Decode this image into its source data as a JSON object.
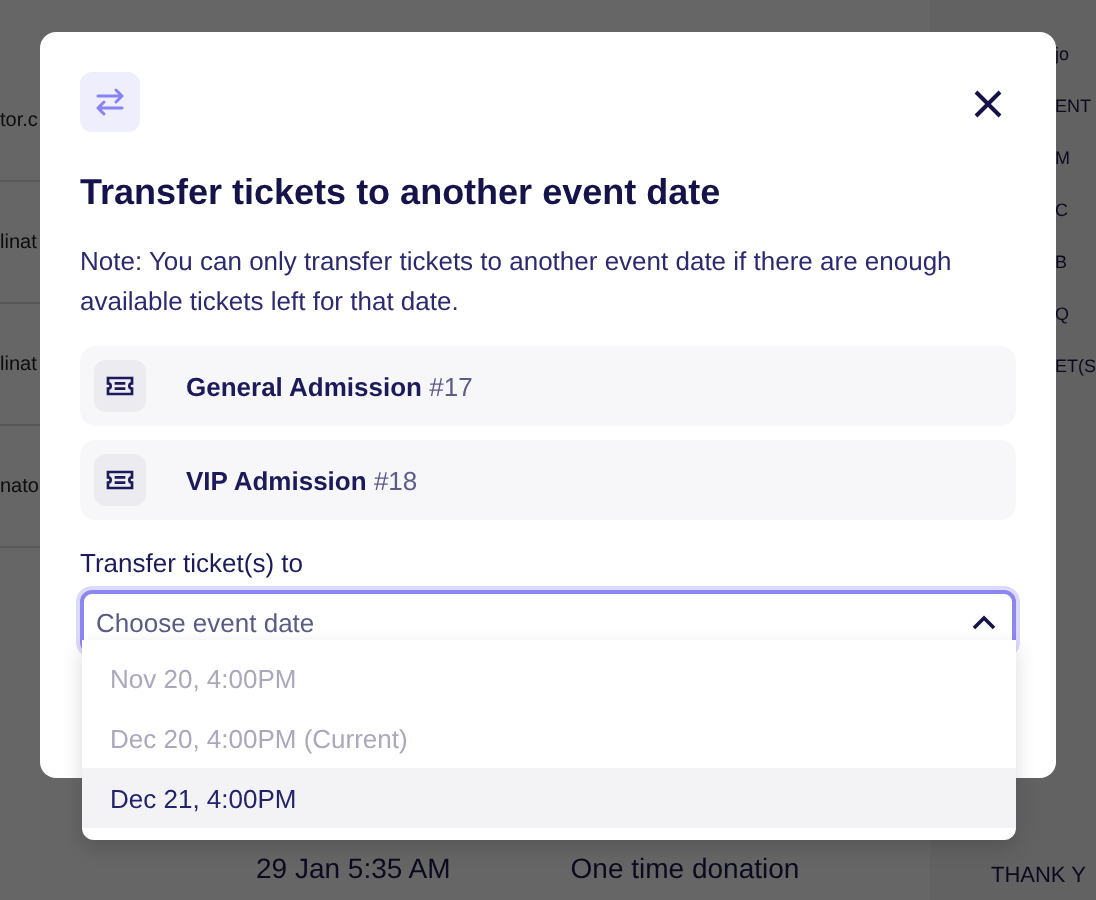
{
  "background": {
    "left_fragments": [
      "tor.c",
      "linat",
      "linat",
      "nato"
    ],
    "right_fragments": [
      "jo",
      "ENT",
      "M",
      "C",
      "B",
      "Q",
      "ET(S",
      "THANK Y"
    ],
    "row": {
      "date": "29 Jan 5:35 AM",
      "type": "One time donation"
    }
  },
  "dialog": {
    "title": "Transfer tickets to another event date",
    "note": "Note: You can only transfer tickets to another event date if there are enough available tickets left for that date.",
    "tickets": [
      {
        "name": "General Admission",
        "number": "#17"
      },
      {
        "name": "VIP Admission",
        "number": "#18"
      }
    ],
    "field_label": "Transfer ticket(s) to",
    "select": {
      "placeholder": "Choose event date",
      "expanded": true
    },
    "options": [
      {
        "label": "Nov 20, 4:00PM",
        "disabled": true,
        "selected": false
      },
      {
        "label": "Dec 20, 4:00PM (Current)",
        "disabled": true,
        "selected": false
      },
      {
        "label": "Dec 21, 4:00PM",
        "disabled": false,
        "selected": true
      }
    ]
  }
}
